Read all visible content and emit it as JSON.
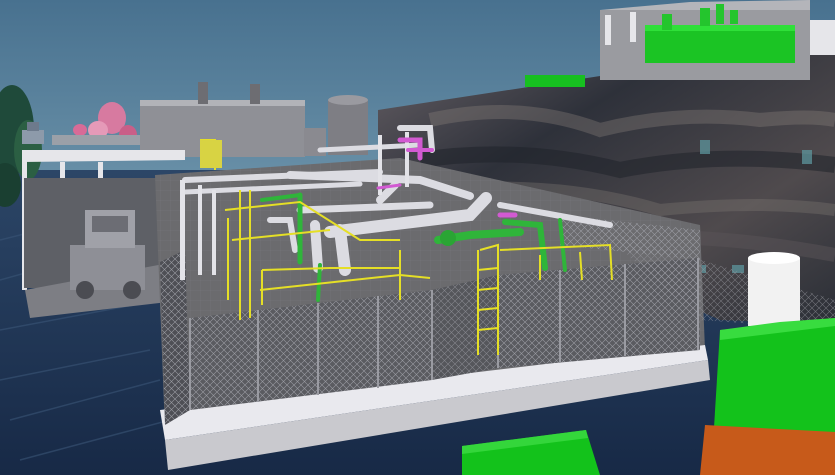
{
  "scene": {
    "kind": "3d-plant-model-render",
    "colors": {
      "sky": "#557e9a",
      "sky_top": "#4a7491",
      "water": "#22385a",
      "deck": "#6e6e70",
      "deck_light": "#8a8a8c",
      "platform_edge": "#e9e9ee",
      "fence": "#7a7b80",
      "pipe_white": "#d9d9df",
      "pipe_green": "#2fb53a",
      "pipe_magenta": "#d25ad2",
      "rail_yellow": "#e7e12a",
      "box_green": "#13c21b",
      "box_orange": "#c75a1a",
      "rock_wall": "#3a3c45",
      "tank_white": "#f2f2f2"
    },
    "icons": [
      "tree-icon",
      "ship-icon",
      "tank-icon",
      "stack-icon",
      "vehicle-icon"
    ]
  }
}
